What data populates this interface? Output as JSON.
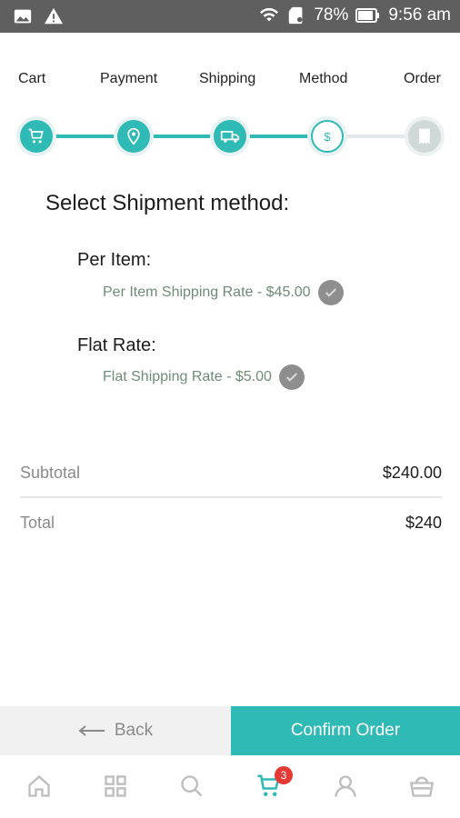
{
  "status_bar": {
    "battery": "78%",
    "time": "9:56 am"
  },
  "steps": [
    {
      "label": "Cart",
      "state": "done",
      "icon": "cart-icon"
    },
    {
      "label": "Payment",
      "state": "done",
      "icon": "location-pin-icon"
    },
    {
      "label": "Shipping",
      "state": "done",
      "icon": "truck-icon"
    },
    {
      "label": "Method",
      "state": "current",
      "icon": "dollar-icon"
    },
    {
      "label": "Order",
      "state": "future",
      "icon": "receipt-icon"
    }
  ],
  "current_step_glyph": "$",
  "shipment": {
    "title": "Select Shipment method:",
    "groups": [
      {
        "title": "Per Item:",
        "option": "Per Item Shipping Rate - $45.00"
      },
      {
        "title": "Flat Rate:",
        "option": "Flat Shipping Rate - $5.00"
      }
    ]
  },
  "summary": {
    "subtotal_label": "Subtotal",
    "subtotal_value": "$240.00",
    "total_label": "Total",
    "total_value": "$240"
  },
  "actions": {
    "back_label": "Back",
    "confirm_label": "Confirm Order"
  },
  "bottom_nav": {
    "items": [
      "home-icon",
      "grid-icon",
      "search-icon",
      "cart-icon",
      "profile-icon",
      "basket-icon"
    ],
    "cart_badge": "3"
  },
  "colors": {
    "accent": "#2fbab5",
    "status_bar": "#5f5f5f",
    "option_text": "#6f8c79",
    "badge": "#e53935"
  }
}
